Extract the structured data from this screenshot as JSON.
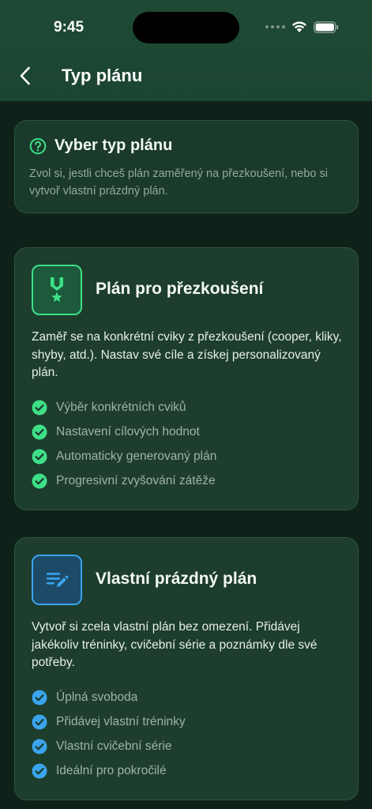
{
  "status_bar": {
    "time": "9:45"
  },
  "nav": {
    "title": "Typ plánu"
  },
  "info": {
    "title": "Vyber typ plánu",
    "description": "Zvol si, jestli chceš plán zaměřený na přezkoušení, nebo si vytvoř vlastní prázdný plán."
  },
  "plans": [
    {
      "title": "Plán pro přezkoušení",
      "description": "Zaměř se na konkrétní cviky z přezkoušení (cooper, kliky, shyby, atd.). Nastav své cíle a získej personalizovaný plán.",
      "icon": "military-medal-icon",
      "accent": "#3ee087",
      "features": [
        "Výběr konkrétních cviků",
        "Nastavení cílových hodnot",
        "Automaticky generovaný plán",
        "Progresivní zvyšování zátěže"
      ]
    },
    {
      "title": "Vlastní prázdný plán",
      "description": "Vytvoř si zcela vlastní plán bez omezení. Přidávej jakékoliv tréninky, cvičební série a poznámky dle své potřeby.",
      "icon": "edit-note-icon",
      "accent": "#3aa4ee",
      "features": [
        "Úplná svoboda",
        "Přidávej vlastní tréninky",
        "Vlastní cvičební série",
        "Ideální pro pokročilé"
      ]
    }
  ]
}
